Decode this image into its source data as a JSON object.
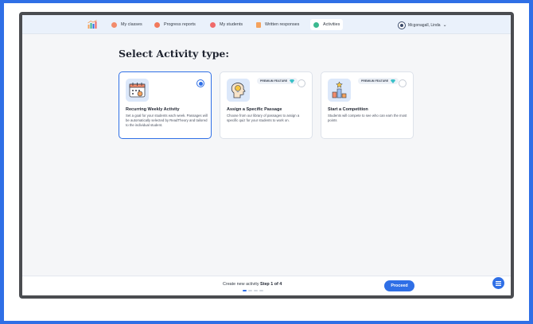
{
  "nav": {
    "items": [
      {
        "label": "My classes",
        "icon": "classes-icon",
        "color": "#f28b6b"
      },
      {
        "label": "Progress reports",
        "icon": "progress-icon",
        "color": "#f2795b"
      },
      {
        "label": "My students",
        "icon": "students-icon",
        "color": "#f06a6a"
      },
      {
        "label": "Written responses",
        "icon": "written-icon",
        "color": "#f5a25d"
      },
      {
        "label": "Activities",
        "icon": "activities-icon",
        "color": "#3cb98f"
      }
    ],
    "user_name": "Mcgonagall, Linda"
  },
  "page": {
    "title": "Select Activity type:"
  },
  "cards": [
    {
      "title": "Recurring Weekly Activity",
      "description": "Set a goal for your students each week. Passages will be automatically selected by ReadTheory and tailored to the individual student.",
      "icon": "calendar-icon",
      "premium": false,
      "selected": true
    },
    {
      "title": "Assign a Specific Passage",
      "description": "Choose from our library of passages to assign a specific quiz for your students to work on.",
      "icon": "lightbulb-head-icon",
      "premium": true,
      "premium_label": "PREMIUM FEATURE",
      "selected": false
    },
    {
      "title": "Start a Competition",
      "description": "Students will compete to see who can earn the most points",
      "icon": "podium-trophy-icon",
      "premium": true,
      "premium_label": "PREMIUM FEATURE",
      "selected": false
    }
  ],
  "footer": {
    "step_prefix": "Create new activity",
    "step_label": "Step 1 of 4",
    "proceed_label": "Proceed"
  },
  "colors": {
    "accent": "#2f6fe6",
    "premium_gem": "#3cc1c8"
  }
}
